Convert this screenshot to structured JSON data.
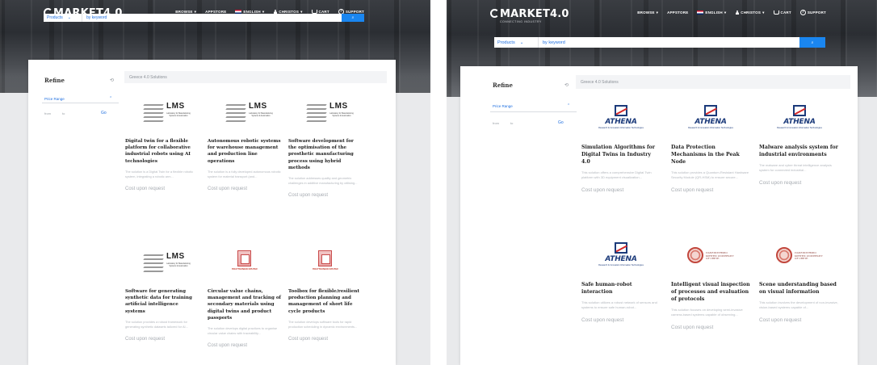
{
  "header": {
    "logo": "MARKET4.0",
    "logo_tagline": "CONNECTING INDUSTRY",
    "nav": {
      "browse": "BROWSE",
      "appstore": "APPSTORE",
      "language": "ENGLISH",
      "user": "CHRISTOS",
      "cart": "CART",
      "support": "SUPPORT"
    },
    "search": {
      "category": "Products",
      "keyword_placeholder": "by keyword"
    }
  },
  "sidebar": {
    "title": "Refine",
    "price_range_label": "Price Range",
    "from_placeholder": "from",
    "to_placeholder": "to",
    "go_label": "Go"
  },
  "left": {
    "breadcrumb": "Greece 4.0 Solutions",
    "products": [
      {
        "title": "Digital twin for a flexible platform for collaborative industrial robots using AI technologies",
        "desc": "The solution is a Digital Twin for a flexible robotic system, integrating a robotic arm...",
        "cost": "Cost upon request",
        "logo": "lms",
        "logo_text": "LMS",
        "logo_sub": "Laboratory for Manufacturing Systems & Automation"
      },
      {
        "title": "Autonomous robotic systems for warehouse management and production line operations",
        "desc": "The solution is a fully developed autonomous robotic system for material transport (and...",
        "cost": "Cost upon request",
        "logo": "lms",
        "logo_text": "LMS",
        "logo_sub": "Laboratory for Manufacturing Systems & Automation"
      },
      {
        "title": "Software development for the optimisation of the prosthetic manufacturing process using hybrid methods",
        "desc": "The solution addresses quality and geometric challenges in additive manufacturing by utilising...",
        "cost": "Cost upon request",
        "logo": "lms",
        "logo_text": "LMS",
        "logo_sub": "Laboratory for Manufacturing Systems & Automation"
      },
      {
        "title": "Software for generating synthetic data for training artificial intelligence systems",
        "desc": "The solution provides a robust framework for generating synthetic datasets tailored for AI...",
        "cost": "Cost upon request",
        "logo": "lms",
        "logo_text": "LMS",
        "logo_sub": "Laboratory for Manufacturing Systems & Automation"
      },
      {
        "title": "Circular value chains, management and tracking of secondary materials using digital twins and product passports",
        "desc": "The solution develops digital practices to organise circular value chains with traceability...",
        "cost": "Cost upon request",
        "logo": "poly",
        "logo_text": "ΠΟΛΥΤΕΧΝΕΙΟ ΚΡΗΤΗΣ"
      },
      {
        "title": "Toolbox for flexible/resilient production planning and management of short life cycle products",
        "desc": "The solution develops software tools for rapid production scheduling in dynamic environments...",
        "cost": "Cost upon request",
        "logo": "poly",
        "logo_text": "ΠΟΛΥΤΕΧΝΕΙΟ ΚΡΗΤΗΣ"
      }
    ]
  },
  "right": {
    "breadcrumb": "Greece 4.0 Solutions",
    "products": [
      {
        "title": "Simulation Algorithms for Digital Twins in Industry 4.0",
        "desc": "This solution offers a comprehensive Digital Twin platform with 3D equipment visualization...",
        "cost": "Cost upon request",
        "logo": "athena",
        "logo_text": "ATHENA",
        "logo_sub": "Research & Innovation Information Technologies"
      },
      {
        "title": "Data Protection Mechanisms in the Peak Node",
        "desc": "This solution provides a Quantum-Resistant Hardware Security Module (QR-HSM) to ensure secure...",
        "cost": "Cost upon request",
        "logo": "athena",
        "logo_text": "ATHENA",
        "logo_sub": "Research & Innovation Information Technologies"
      },
      {
        "title": "Malware analysis system for industrial environments",
        "desc": "The malware and cyber threat intelligence analysis system for connected industrial...",
        "cost": "Cost upon request",
        "logo": "athena",
        "logo_text": "ATHENA",
        "logo_sub": "Research & Innovation Information Technologies"
      },
      {
        "title": "Safe human-robot interaction",
        "desc": "This solution utilizes a robust network of sensors and systems to ensure safe human-robot...",
        "cost": "Cost upon request",
        "logo": "athena",
        "logo_text": "ATHENA",
        "logo_sub": "Research & Innovation Information Technologies"
      },
      {
        "title": "Intelligent visual inspection of processes and evaluation of protocols",
        "desc": "This solution focuses on developing semi-invasive camera-based systems capable of observing...",
        "cost": "Cost upon request",
        "logo": "seal",
        "logo_text": "ΠΑΝΕΠΙΣΤΗΜΙΟ ΚΡΗΤΗΣ UNIVERSITY OF CRETE"
      },
      {
        "title": "Scene understanding based on visual information",
        "desc": "This solution involves the development of non-invasive, vision-based systems capable of...",
        "cost": "Cost upon request",
        "logo": "seal",
        "logo_text": "ΠΑΝΕΠΙΣΤΗΜΙΟ ΚΡΗΤΗΣ UNIVERSITY OF CRETE"
      }
    ]
  },
  "colors": {
    "accent": "#1a86f0",
    "link": "#1f6fe0",
    "athena_blue": "#1b3a7a",
    "crete_red": "#c2473d"
  }
}
